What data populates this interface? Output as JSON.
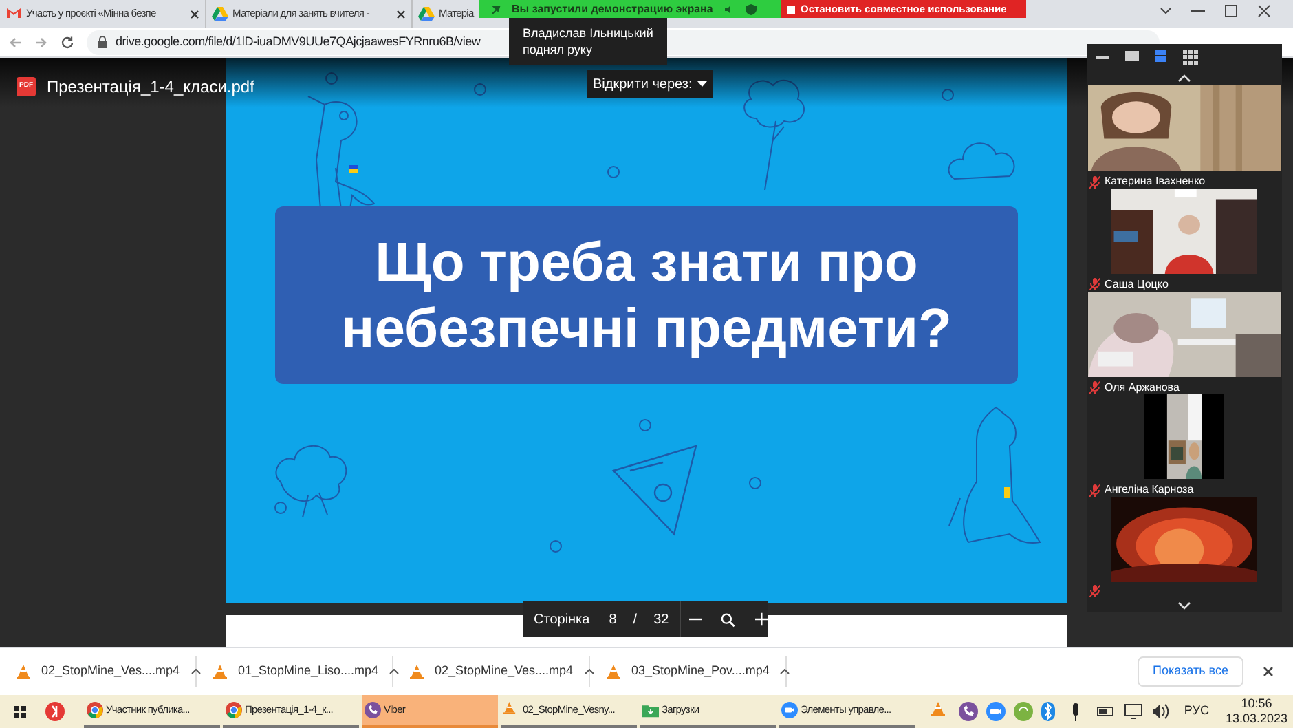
{
  "browser": {
    "tabs": [
      {
        "kind": "gmail",
        "title": "Участь у проєкті «Мінна безпе"
      },
      {
        "kind": "drive",
        "title": "Матеріали для занять вчителя -"
      },
      {
        "kind": "drive",
        "title": "Матеріа"
      }
    ],
    "url": "drive.google.com/file/d/1lD-iuaDMV9UUe7QAjcjaawesFYRnru6B/view"
  },
  "sharing_bar": {
    "message": "Вы запустили демонстрацию экрана",
    "stop_button": "Остановить совместное использование"
  },
  "notification": {
    "text": "Владислав Ільницький поднял руку"
  },
  "viewer": {
    "file_name": "Презентація_1-4_класи.pdf",
    "file_badge": "PDF",
    "open_with": "Відкрити через:",
    "slide_title": "Що треба знати про небезпечні предмети?",
    "page_label": "Сторінка",
    "page": "8",
    "page_separator": "/",
    "page_count": "32"
  },
  "video_panel": {
    "view_modes": [
      {
        "kind": "minimize",
        "selected": false
      },
      {
        "kind": "single",
        "selected": false
      },
      {
        "kind": "speaker",
        "selected": true
      },
      {
        "kind": "grid",
        "selected": false
      }
    ],
    "participants": [
      {
        "name": "Катерина Івахненко",
        "muted": true
      },
      {
        "name": "Саша Цоцко",
        "muted": true
      },
      {
        "name": "Оля Аржанова",
        "muted": true
      },
      {
        "name": "Ангеліна Карноза",
        "muted": true
      },
      {
        "muted": true
      }
    ]
  },
  "downloads": {
    "items": [
      "02_StopMine_Ves....mp4",
      "01_StopMine_Liso....mp4",
      "02_StopMine_Ves....mp4",
      "03_StopMine_Pov....mp4"
    ],
    "show_all": "Показать все"
  },
  "taskbar": {
    "apps": [
      {
        "kind": "chrome",
        "label": "Участник публика...",
        "selected": false
      },
      {
        "kind": "chrome",
        "label": "Презентація_1-4_к...",
        "selected": false
      },
      {
        "kind": "viber",
        "label": "Viber",
        "selected": true
      },
      {
        "kind": "vlc",
        "label": "02_StopMine_Vesny...",
        "selected": false
      },
      {
        "kind": "folder",
        "label": "Загрузки",
        "selected": false
      },
      {
        "kind": "zoom",
        "label": "Элементы управле...",
        "selected": false
      }
    ],
    "language": "РУС",
    "time": "10:56",
    "date": "13.03.2023"
  }
}
